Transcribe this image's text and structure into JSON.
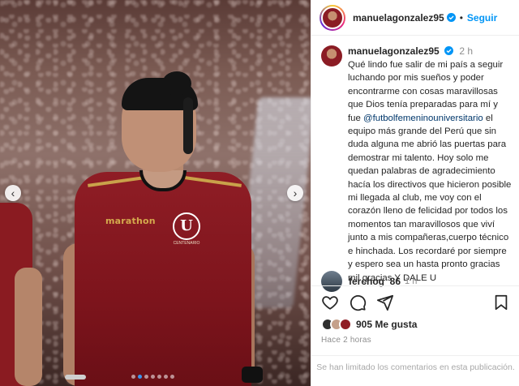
{
  "post": {
    "username": "manuelagonzalez95",
    "follow_label": "Seguir",
    "separator": "•",
    "time_ago": "2 h",
    "caption_lines_before_mention": "Qué lindo fue salir de mi país a seguir luchando por mis sueños y poder encontrarme con cosas maravillosas que Dios tenía preparadas para mí y fue ",
    "mention": "@futbolfemeninouniversitario",
    "caption_after_mention": " el equipo más grande del Perú que sin duda alguna me abrió las puertas para demostrar mi talento. Hoy solo me quedan palabras de agradecimiento hacía los directivos que hicieron posible mi llegada al club, me voy con el corazón lleno de felicidad por todos los momentos tan maravillosos que viví junto a mis compañeras,cuerpo técnico e hinchada. Los recordaré por siempre y espero sea un hasta pronto gracias mil gracias Y DALE U"
  },
  "photo": {
    "jersey_brand": "marathon",
    "crest_letter": "U",
    "crest_sub": "CENTENARIO",
    "carousel_dots": 7,
    "active_dot": 1
  },
  "comment": {
    "username": "ferchog_86",
    "time_ago": "1 h"
  },
  "actions": {
    "icons": [
      "heart-icon",
      "comment-icon",
      "share-icon",
      "bookmark-icon"
    ],
    "likes_count": "905",
    "likes_label": "Me gusta",
    "posted": "Hace 2 horas"
  },
  "footer": {
    "limited_comments": "Se han limitado los comentarios en esta publicación."
  },
  "colors": {
    "accent": "#0095f6",
    "verified": "#0095f6",
    "mention": "#00376b",
    "jersey": "#8f1d25"
  }
}
